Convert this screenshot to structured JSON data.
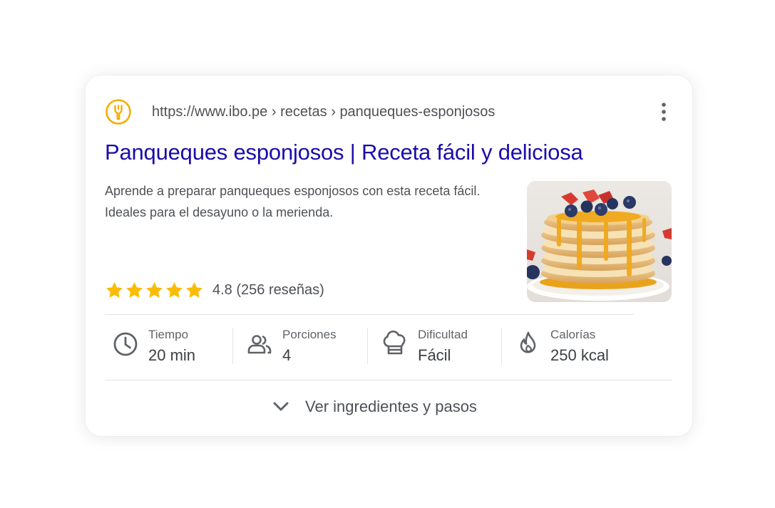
{
  "result": {
    "url": "https://www.ibo.pe › recetas › panqueques-esponjosos",
    "title": "Panqueques esponjosos | Receta fácil y deliciosa",
    "snippet_lines": [
      "Aprende a preparar panqueques esponjosos con esta receta fácil.",
      "Ideales para el desayuno o la merienda."
    ],
    "rating": {
      "stars": 5,
      "text": "4.8 (256 reseñas)",
      "star_color": "#fbbc04"
    },
    "favicon_icon": "fork-icon",
    "favicon_color": "#f9ab00",
    "title_color": "#1a0dab"
  },
  "meta": [
    {
      "icon": "clock-icon",
      "label": "Tiempo",
      "value": "20 min"
    },
    {
      "icon": "people-icon",
      "label": "Porciones",
      "value": "4"
    },
    {
      "icon": "chef-hat-icon",
      "label": "Dificultad",
      "value": "Fácil"
    },
    {
      "icon": "flame-icon",
      "label": "Calorías",
      "value": "250 kcal"
    }
  ],
  "expand": {
    "label": "Ver ingredientes y pasos",
    "icon": "chevron-down-icon"
  }
}
